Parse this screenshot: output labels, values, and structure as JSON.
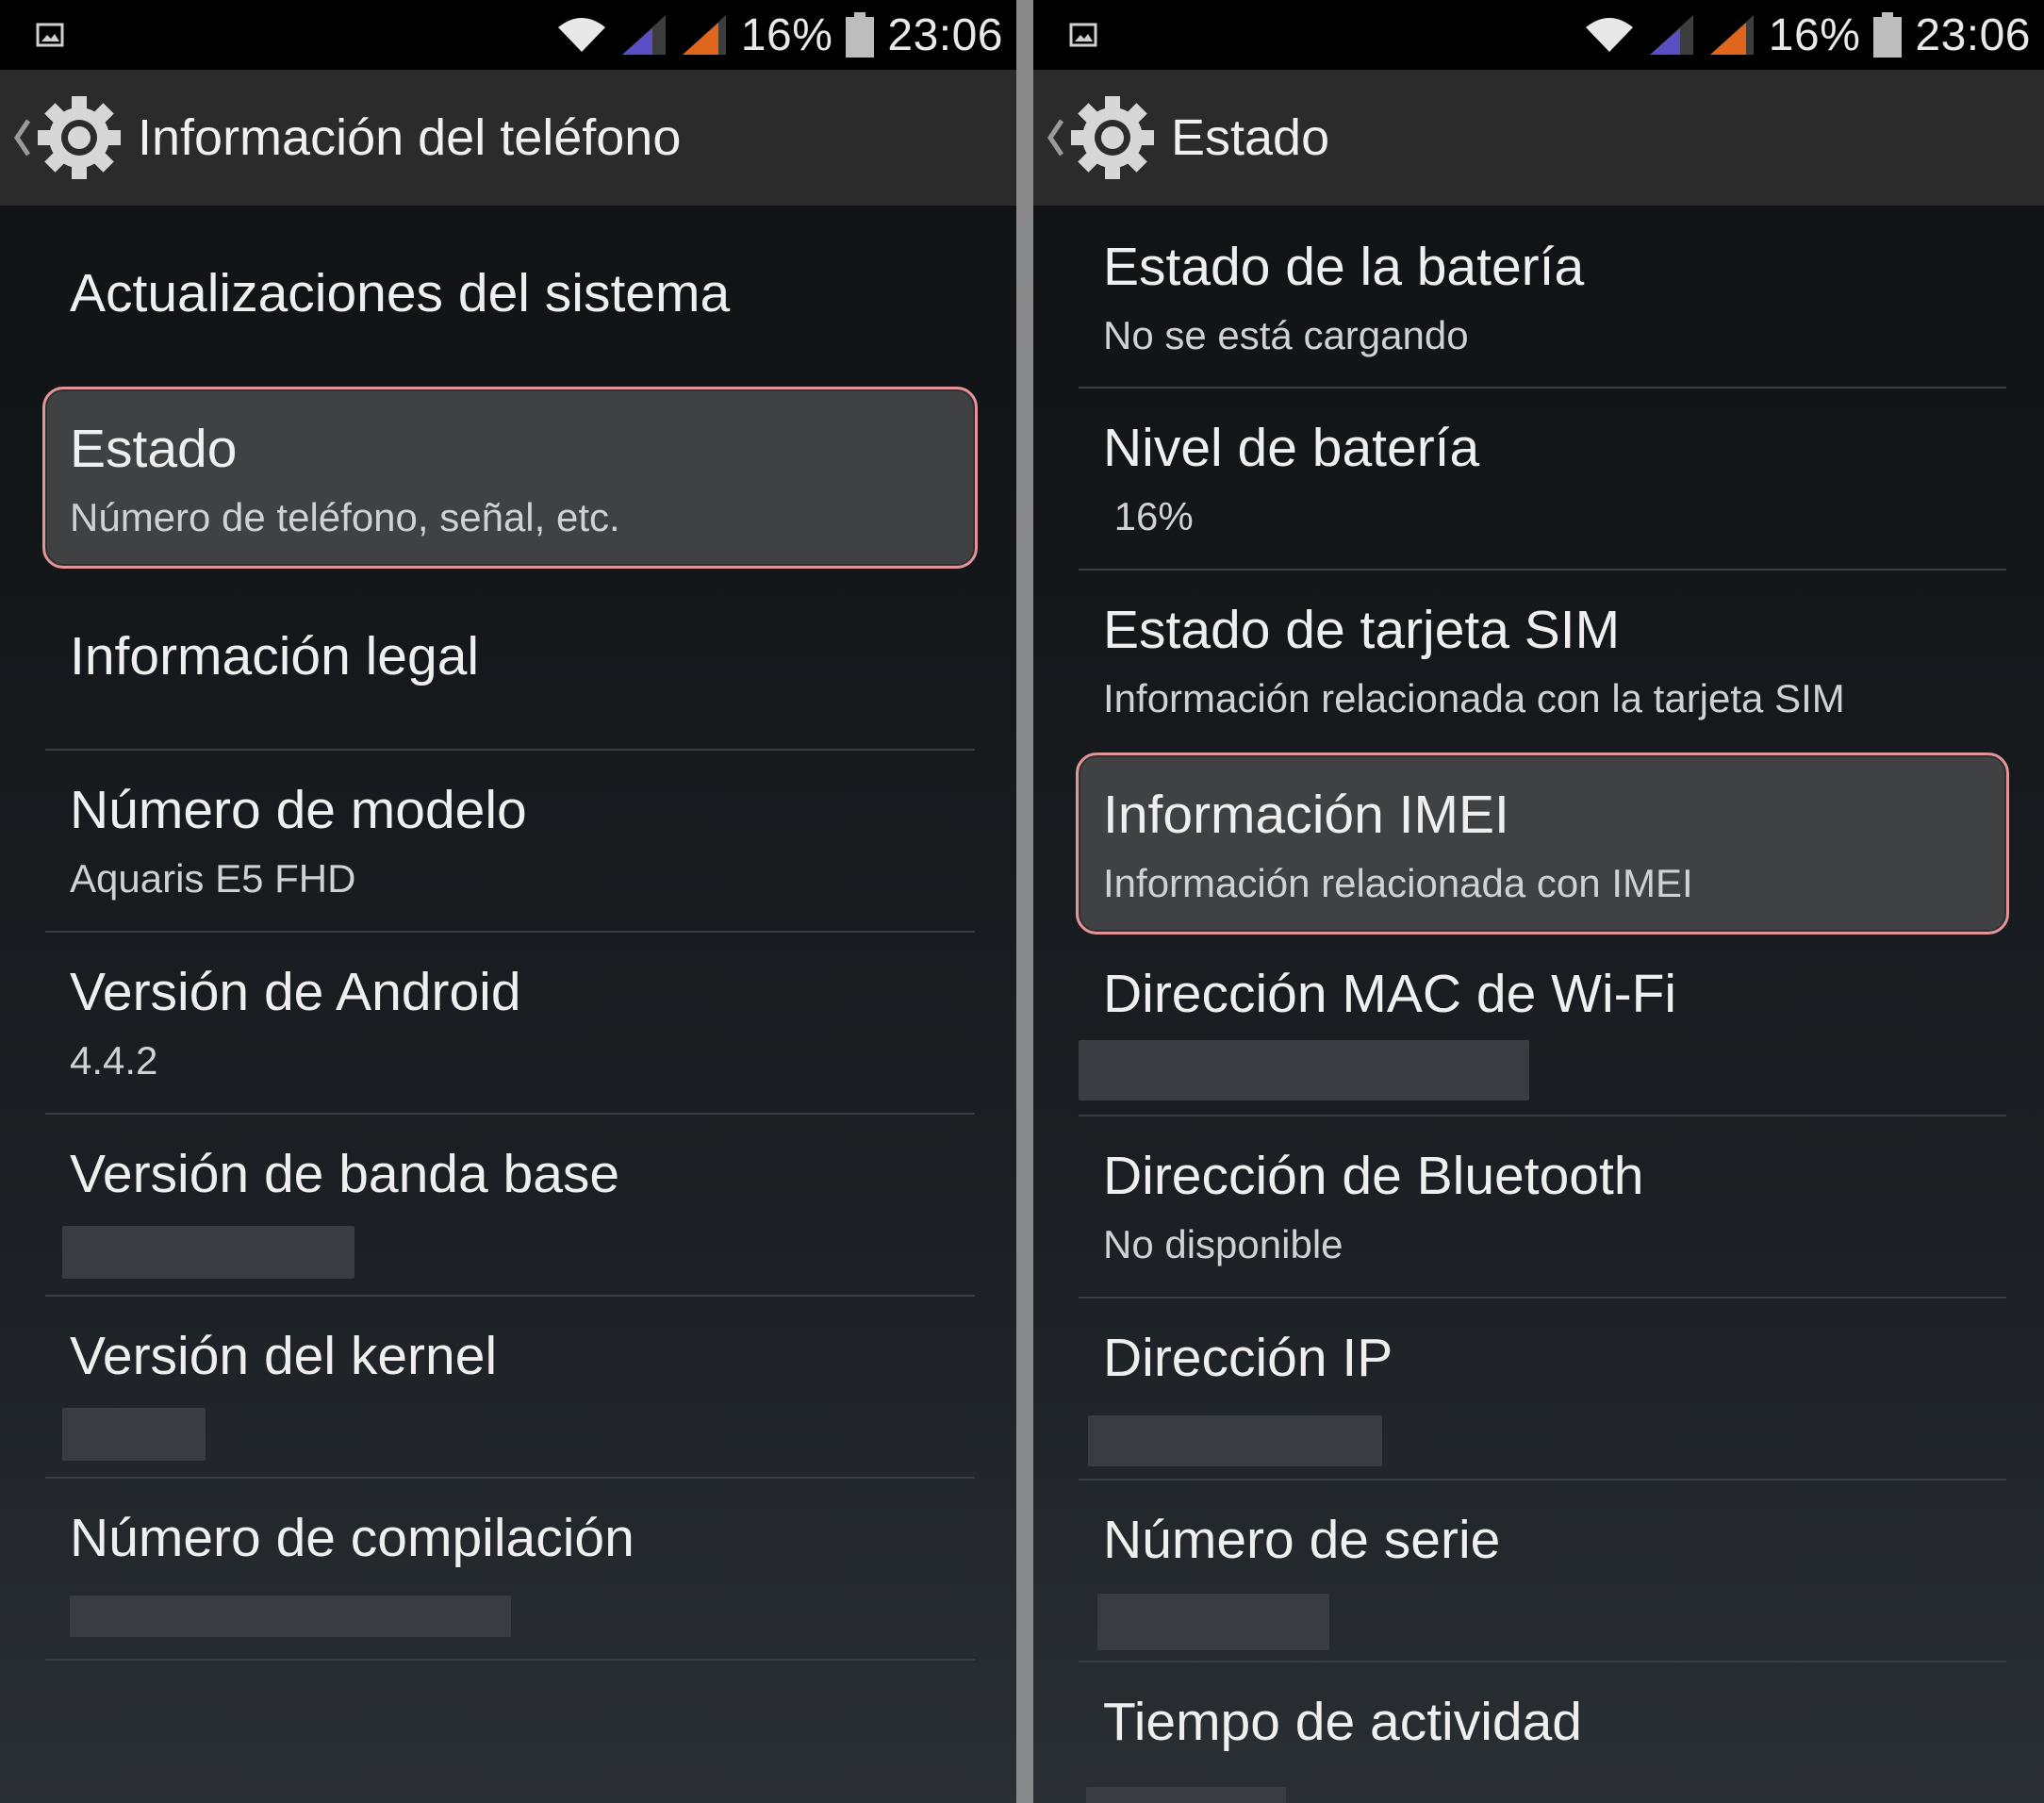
{
  "colors": {
    "status_bar_bg": "#000000",
    "action_bar_bg": "#2b2b2b",
    "highlight_bg": "#404143",
    "highlight_border": "#e39496",
    "signal_sim1": "#5a4fc4",
    "signal_sim2": "#e0661e"
  },
  "left": {
    "status_bar": {
      "battery": "16%",
      "time": "23:06"
    },
    "action_bar": {
      "title": "Información del teléfono",
      "icon": "settings-gear-icon"
    },
    "items": [
      {
        "title": "Actualizaciones del sistema"
      },
      {
        "title": "Estado",
        "summary": "Número de teléfono, señal, etc."
      },
      {
        "title": "Información legal"
      },
      {
        "title": "Número de modelo",
        "summary": "Aquaris E5 FHD"
      },
      {
        "title": "Versión de Android",
        "summary": "4.4.2"
      },
      {
        "title": "Versión de banda base"
      },
      {
        "title": "Versión del kernel"
      },
      {
        "title": "Número de compilación"
      }
    ]
  },
  "right": {
    "status_bar": {
      "battery": "16%",
      "time": "23:06"
    },
    "action_bar": {
      "title": "Estado",
      "icon": "settings-gear-icon"
    },
    "items": [
      {
        "title": "Estado de la batería",
        "summary": "No se está cargando"
      },
      {
        "title": "Nivel de batería",
        "summary": " 16%"
      },
      {
        "title": "Estado de tarjeta SIM",
        "summary": "Información relacionada con la tarjeta SIM"
      },
      {
        "title": "Información IMEI",
        "summary": "Información relacionada con IMEI"
      },
      {
        "title": "Dirección MAC de Wi-Fi"
      },
      {
        "title": "Dirección de Bluetooth",
        "summary": "No disponible"
      },
      {
        "title": "Dirección IP"
      },
      {
        "title": "Número de serie"
      },
      {
        "title": "Tiempo de actividad"
      }
    ]
  }
}
